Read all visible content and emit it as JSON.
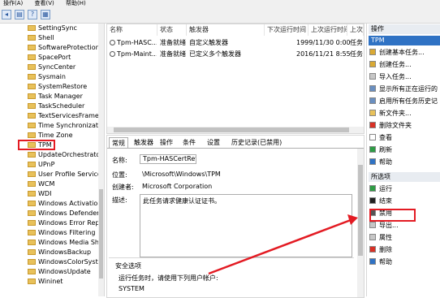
{
  "menubar": {
    "items": [
      "操作(A)",
      "查看(V)",
      "帮助(H)"
    ]
  },
  "tree": {
    "items": [
      "SettingSync",
      "Shell",
      "SoftwareProtection",
      "SpacePort",
      "SyncCenter",
      "Sysmain",
      "SystemRestore",
      "Task Manager",
      "TaskScheduler",
      "TextServicesFramework",
      "Time Synchronization",
      "Time Zone",
      "TPM",
      "UpdateOrchestrator",
      "UPnP",
      "User Profile Service",
      "WCM",
      "WDI",
      "Windows Activation",
      "Windows Defender",
      "Windows Error Reporting",
      "Windows Filtering",
      "Windows Media Sharing",
      "WindowsBackup",
      "WindowsColorSystem",
      "WindowsUpdate",
      "Wininet"
    ],
    "selected": "TPM"
  },
  "tasks": {
    "headers": [
      "名称",
      "状态",
      "触发器",
      "下次运行时间",
      "上次运行时间",
      "上次"
    ],
    "rows": [
      {
        "name": "Tpm-HASC...",
        "status": "准备就绪",
        "trigger": "自定义触发器",
        "next": "",
        "last": "1999/11/30 0:00:00",
        "result": "任务"
      },
      {
        "name": "Tpm-Maint...",
        "status": "准备就绪",
        "trigger": "已定义多个触发器",
        "next": "",
        "last": "2016/11/21 8:55:27",
        "result": "任务"
      }
    ]
  },
  "detail": {
    "tabs": [
      "常规",
      "触发器",
      "操作",
      "条件",
      "设置",
      "历史记录(已禁用)"
    ],
    "labels": {
      "name": "名称:",
      "location": "位置:",
      "author": "创建者:",
      "description": "描述:"
    },
    "name": "Tpm-HASCertRetr",
    "location": "\\Microsoft\\Windows\\TPM",
    "author": "Microsoft Corporation",
    "description": "此任务请求健康认证证书。",
    "security_title": "安全选项",
    "run_as_label": "运行任务时，请使用下列用户帐户:",
    "run_as_user": "SYSTEM"
  },
  "actions": {
    "header": "操作",
    "tpm_section": "TPM",
    "tpm_items": [
      "创建基本任务...",
      "创建任务...",
      "导入任务...",
      "显示所有正在运行的",
      "启用所有任务历史记",
      "新文件夹...",
      "删除文件夹",
      "查看",
      "刷新",
      "帮助"
    ],
    "selected_section": "所选项",
    "selected_items": [
      "运行",
      "结束",
      "禁用",
      "导出...",
      "属性",
      "删除",
      "帮助"
    ]
  },
  "colors": {
    "highlight": "#e31b23",
    "section_blue": "#2f72c4"
  }
}
